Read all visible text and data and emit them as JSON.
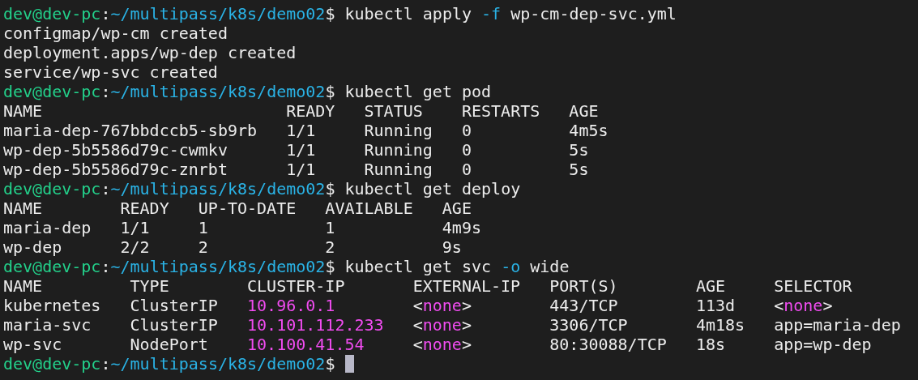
{
  "terminal": {
    "lines": [
      {
        "kind": "prompt",
        "user": "dev@dev-pc",
        "sep": ":",
        "path": "~/multipass/k8s/demo02",
        "symbol": "$",
        "command": [
          {
            "text": "kubectl apply "
          },
          {
            "text": "-f",
            "kind": "flag"
          },
          {
            "text": " wp-cm-dep-svc.yml"
          }
        ],
        "cursor": false
      },
      {
        "kind": "output",
        "text": "configmap/wp-cm created"
      },
      {
        "kind": "output",
        "text": "deployment.apps/wp-dep created"
      },
      {
        "kind": "output",
        "text": "service/wp-svc created"
      },
      {
        "kind": "prompt",
        "user": "dev@dev-pc",
        "sep": ":",
        "path": "~/multipass/k8s/demo02",
        "symbol": "$",
        "command": [
          {
            "text": "kubectl get pod"
          }
        ],
        "cursor": false
      },
      {
        "kind": "table",
        "columns": [
          "NAME",
          "READY",
          "STATUS",
          "RESTARTS",
          "AGE"
        ],
        "rows": [
          [
            "maria-dep-767bbdccb5-sb9rb",
            "1/1",
            "Running",
            "0",
            "4m5s"
          ],
          [
            "wp-dep-5b5586d79c-cwmkv",
            "1/1",
            "Running",
            "0",
            "5s"
          ],
          [
            "wp-dep-5b5586d79c-znrbt",
            "1/1",
            "Running",
            "0",
            "5s"
          ]
        ]
      },
      {
        "kind": "prompt",
        "user": "dev@dev-pc",
        "sep": ":",
        "path": "~/multipass/k8s/demo02",
        "symbol": "$",
        "command": [
          {
            "text": "kubectl get deploy"
          }
        ],
        "cursor": false
      },
      {
        "kind": "table",
        "columns": [
          "NAME",
          "READY",
          "UP-TO-DATE",
          "AVAILABLE",
          "AGE"
        ],
        "rows": [
          [
            "maria-dep",
            "1/1",
            "1",
            "1",
            "4m9s"
          ],
          [
            "wp-dep",
            "2/2",
            "2",
            "2",
            "9s"
          ]
        ]
      },
      {
        "kind": "prompt",
        "user": "dev@dev-pc",
        "sep": ":",
        "path": "~/multipass/k8s/demo02",
        "symbol": "$",
        "command": [
          {
            "text": "kubectl get svc "
          },
          {
            "text": "-o",
            "kind": "flag"
          },
          {
            "text": " wide"
          }
        ],
        "cursor": false
      },
      {
        "kind": "table",
        "columns": [
          "NAME",
          "TYPE",
          "CLUSTER-IP",
          "EXTERNAL-IP",
          "PORT(S)",
          "AGE",
          "SELECTOR"
        ],
        "rows": [
          [
            "kubernetes",
            "ClusterIP",
            [
              {
                "text": "10.96.0.1",
                "kind": "highlight"
              }
            ],
            [
              {
                "text": "<"
              },
              {
                "text": "none",
                "kind": "highlight"
              },
              {
                "text": ">"
              }
            ],
            "443/TCP",
            "113d",
            [
              {
                "text": "<"
              },
              {
                "text": "none",
                "kind": "highlight"
              },
              {
                "text": ">"
              }
            ]
          ],
          [
            "maria-svc",
            "ClusterIP",
            [
              {
                "text": "10.101.112.233",
                "kind": "highlight"
              }
            ],
            [
              {
                "text": "<"
              },
              {
                "text": "none",
                "kind": "highlight"
              },
              {
                "text": ">"
              }
            ],
            "3306/TCP",
            "4m18s",
            "app=maria-dep"
          ],
          [
            "wp-svc",
            "NodePort",
            [
              {
                "text": "10.100.41.54",
                "kind": "highlight"
              }
            ],
            [
              {
                "text": "<"
              },
              {
                "text": "none",
                "kind": "highlight"
              },
              {
                "text": ">"
              }
            ],
            "80:30088/TCP",
            "18s",
            "app=wp-dep"
          ]
        ]
      },
      {
        "kind": "prompt",
        "user": "dev@dev-pc",
        "sep": ":",
        "path": "~/multipass/k8s/demo02",
        "symbol": "$",
        "cursor": true
      }
    ]
  }
}
